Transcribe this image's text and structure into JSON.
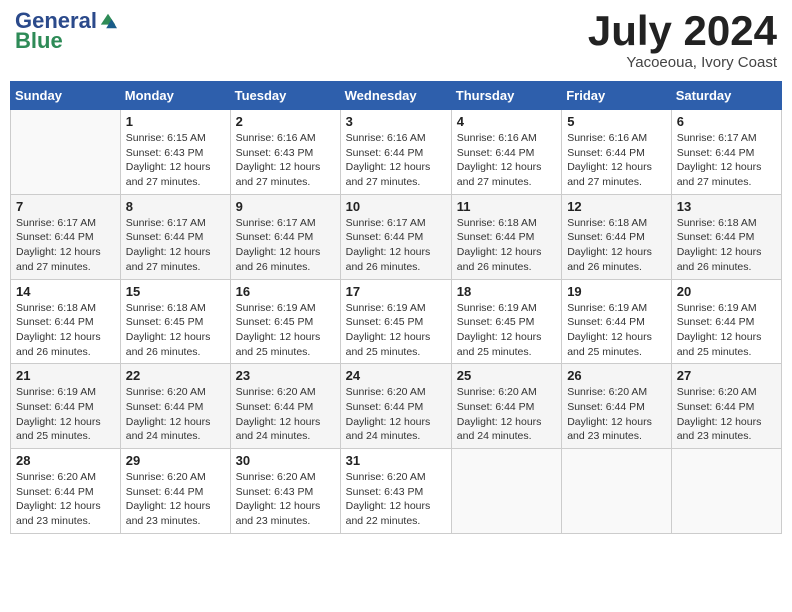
{
  "header": {
    "logo_line1": "General",
    "logo_line2": "Blue",
    "month_year": "July 2024",
    "location": "Yacoeoua, Ivory Coast"
  },
  "days_of_week": [
    "Sunday",
    "Monday",
    "Tuesday",
    "Wednesday",
    "Thursday",
    "Friday",
    "Saturday"
  ],
  "weeks": [
    [
      {
        "num": "",
        "info": ""
      },
      {
        "num": "1",
        "info": "Sunrise: 6:15 AM\nSunset: 6:43 PM\nDaylight: 12 hours\nand 27 minutes."
      },
      {
        "num": "2",
        "info": "Sunrise: 6:16 AM\nSunset: 6:43 PM\nDaylight: 12 hours\nand 27 minutes."
      },
      {
        "num": "3",
        "info": "Sunrise: 6:16 AM\nSunset: 6:44 PM\nDaylight: 12 hours\nand 27 minutes."
      },
      {
        "num": "4",
        "info": "Sunrise: 6:16 AM\nSunset: 6:44 PM\nDaylight: 12 hours\nand 27 minutes."
      },
      {
        "num": "5",
        "info": "Sunrise: 6:16 AM\nSunset: 6:44 PM\nDaylight: 12 hours\nand 27 minutes."
      },
      {
        "num": "6",
        "info": "Sunrise: 6:17 AM\nSunset: 6:44 PM\nDaylight: 12 hours\nand 27 minutes."
      }
    ],
    [
      {
        "num": "7",
        "info": "Sunrise: 6:17 AM\nSunset: 6:44 PM\nDaylight: 12 hours\nand 27 minutes."
      },
      {
        "num": "8",
        "info": "Sunrise: 6:17 AM\nSunset: 6:44 PM\nDaylight: 12 hours\nand 27 minutes."
      },
      {
        "num": "9",
        "info": "Sunrise: 6:17 AM\nSunset: 6:44 PM\nDaylight: 12 hours\nand 26 minutes."
      },
      {
        "num": "10",
        "info": "Sunrise: 6:17 AM\nSunset: 6:44 PM\nDaylight: 12 hours\nand 26 minutes."
      },
      {
        "num": "11",
        "info": "Sunrise: 6:18 AM\nSunset: 6:44 PM\nDaylight: 12 hours\nand 26 minutes."
      },
      {
        "num": "12",
        "info": "Sunrise: 6:18 AM\nSunset: 6:44 PM\nDaylight: 12 hours\nand 26 minutes."
      },
      {
        "num": "13",
        "info": "Sunrise: 6:18 AM\nSunset: 6:44 PM\nDaylight: 12 hours\nand 26 minutes."
      }
    ],
    [
      {
        "num": "14",
        "info": "Sunrise: 6:18 AM\nSunset: 6:44 PM\nDaylight: 12 hours\nand 26 minutes."
      },
      {
        "num": "15",
        "info": "Sunrise: 6:18 AM\nSunset: 6:45 PM\nDaylight: 12 hours\nand 26 minutes."
      },
      {
        "num": "16",
        "info": "Sunrise: 6:19 AM\nSunset: 6:45 PM\nDaylight: 12 hours\nand 25 minutes."
      },
      {
        "num": "17",
        "info": "Sunrise: 6:19 AM\nSunset: 6:45 PM\nDaylight: 12 hours\nand 25 minutes."
      },
      {
        "num": "18",
        "info": "Sunrise: 6:19 AM\nSunset: 6:45 PM\nDaylight: 12 hours\nand 25 minutes."
      },
      {
        "num": "19",
        "info": "Sunrise: 6:19 AM\nSunset: 6:44 PM\nDaylight: 12 hours\nand 25 minutes."
      },
      {
        "num": "20",
        "info": "Sunrise: 6:19 AM\nSunset: 6:44 PM\nDaylight: 12 hours\nand 25 minutes."
      }
    ],
    [
      {
        "num": "21",
        "info": "Sunrise: 6:19 AM\nSunset: 6:44 PM\nDaylight: 12 hours\nand 25 minutes."
      },
      {
        "num": "22",
        "info": "Sunrise: 6:20 AM\nSunset: 6:44 PM\nDaylight: 12 hours\nand 24 minutes."
      },
      {
        "num": "23",
        "info": "Sunrise: 6:20 AM\nSunset: 6:44 PM\nDaylight: 12 hours\nand 24 minutes."
      },
      {
        "num": "24",
        "info": "Sunrise: 6:20 AM\nSunset: 6:44 PM\nDaylight: 12 hours\nand 24 minutes."
      },
      {
        "num": "25",
        "info": "Sunrise: 6:20 AM\nSunset: 6:44 PM\nDaylight: 12 hours\nand 24 minutes."
      },
      {
        "num": "26",
        "info": "Sunrise: 6:20 AM\nSunset: 6:44 PM\nDaylight: 12 hours\nand 23 minutes."
      },
      {
        "num": "27",
        "info": "Sunrise: 6:20 AM\nSunset: 6:44 PM\nDaylight: 12 hours\nand 23 minutes."
      }
    ],
    [
      {
        "num": "28",
        "info": "Sunrise: 6:20 AM\nSunset: 6:44 PM\nDaylight: 12 hours\nand 23 minutes."
      },
      {
        "num": "29",
        "info": "Sunrise: 6:20 AM\nSunset: 6:44 PM\nDaylight: 12 hours\nand 23 minutes."
      },
      {
        "num": "30",
        "info": "Sunrise: 6:20 AM\nSunset: 6:43 PM\nDaylight: 12 hours\nand 23 minutes."
      },
      {
        "num": "31",
        "info": "Sunrise: 6:20 AM\nSunset: 6:43 PM\nDaylight: 12 hours\nand 22 minutes."
      },
      {
        "num": "",
        "info": ""
      },
      {
        "num": "",
        "info": ""
      },
      {
        "num": "",
        "info": ""
      }
    ]
  ]
}
